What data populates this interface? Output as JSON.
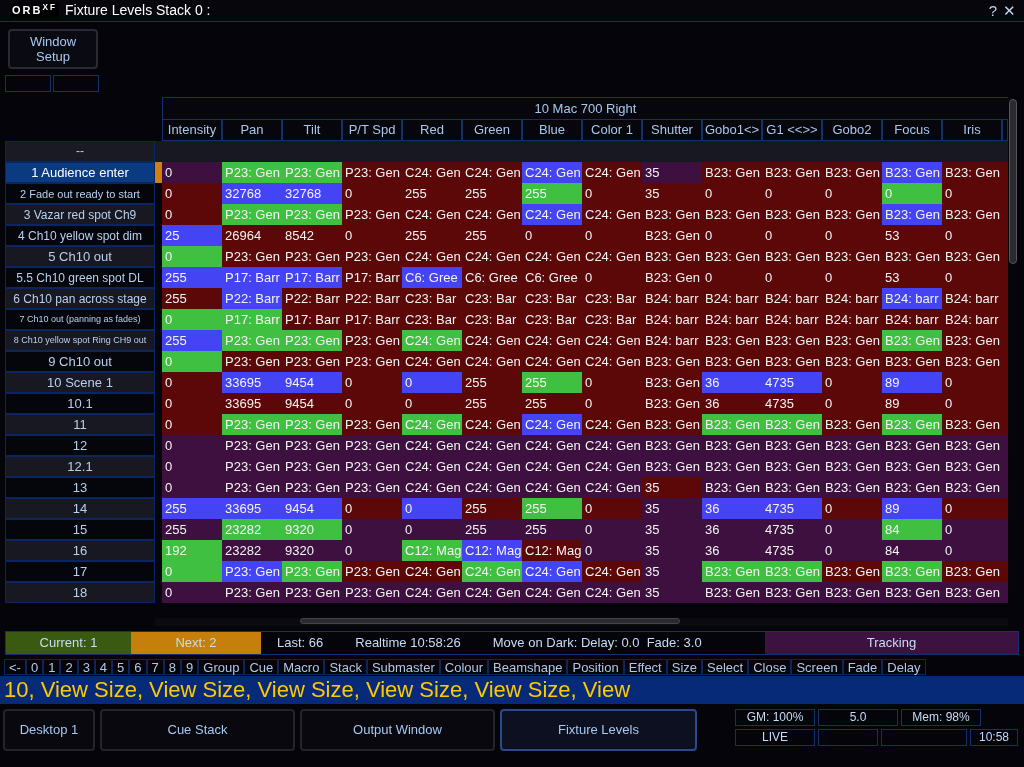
{
  "window": {
    "logo": "ORB$^{XF}$",
    "title": "Fixture Levels Stack 0 :",
    "title_buttons": [
      "?",
      "✕"
    ]
  },
  "window_setup_button": "Window\nSetup",
  "fixture_header": "10 Mac 700 Right",
  "columns": [
    "Intensity",
    "Pan",
    "Tilt",
    "P/T Spd",
    "Red",
    "Green",
    "Blue",
    "Color 1",
    "Shutter",
    "Gobo1<>",
    "G1 <<>>",
    "Gobo2",
    "Focus",
    "Iris"
  ],
  "blank_row": {
    "label": "--"
  },
  "rows": [
    {
      "label": "1 Audience enter",
      "selected": true,
      "color": "#5c0808",
      "cells": [
        {
          "text": "0",
          "color": "#3e1040"
        },
        {
          "text": "P23: Gen",
          "color": "#40c040"
        },
        {
          "text": "P23: Gen",
          "color": "#40c040"
        },
        {
          "text": "P23: Gen"
        },
        {
          "text": "C24: Gen"
        },
        {
          "text": "C24: Gen"
        },
        {
          "text": "C24: Gen",
          "color": "#4444f4"
        },
        {
          "text": "C24: Gen"
        },
        {
          "text": "35",
          "color": "#3e1040"
        },
        {
          "text": "B23: Gen"
        },
        {
          "text": "B23: Gen"
        },
        {
          "text": "B23: Gen"
        },
        {
          "text": "B23: Gen",
          "color": "#4444f4"
        },
        {
          "text": "B23: Gen"
        }
      ]
    },
    {
      "label": "2 Fade out ready to start",
      "selected": false,
      "color": "#5c0808",
      "cells": [
        {
          "text": "0"
        },
        {
          "text": "32768",
          "color": "#4444f4"
        },
        {
          "text": "32768",
          "color": "#4444f4"
        },
        {
          "text": "0"
        },
        {
          "text": "255"
        },
        {
          "text": "255"
        },
        {
          "text": "255",
          "color": "#40c040"
        },
        {
          "text": "0"
        },
        {
          "text": "35"
        },
        {
          "text": "0"
        },
        {
          "text": "0"
        },
        {
          "text": "0"
        },
        {
          "text": "0",
          "color": "#40c040"
        },
        {
          "text": "0"
        }
      ]
    },
    {
      "label": "3 Vazar red spot Ch9",
      "selected": false,
      "color": "#5c0808",
      "cells": [
        {
          "text": "0"
        },
        {
          "text": "P23: Gen",
          "color": "#40c040"
        },
        {
          "text": "P23: Gen",
          "color": "#40c040"
        },
        {
          "text": "P23: Gen"
        },
        {
          "text": "C24: Gen"
        },
        {
          "text": "C24: Gen"
        },
        {
          "text": "C24: Gen",
          "color": "#4444f4"
        },
        {
          "text": "C24: Gen"
        },
        {
          "text": "B23: Gen"
        },
        {
          "text": "B23: Gen"
        },
        {
          "text": "B23: Gen"
        },
        {
          "text": "B23: Gen"
        },
        {
          "text": "B23: Gen",
          "color": "#4444f4"
        },
        {
          "text": "B23: Gen"
        }
      ]
    },
    {
      "label": "4 Ch10 yellow spot dim",
      "selected": false,
      "color": "#5c0808",
      "cells": [
        {
          "text": "25",
          "color": "#4444f4"
        },
        {
          "text": "26964"
        },
        {
          "text": "8542"
        },
        {
          "text": "0"
        },
        {
          "text": "255"
        },
        {
          "text": "255"
        },
        {
          "text": "0"
        },
        {
          "text": "0"
        },
        {
          "text": "B23: Gen"
        },
        {
          "text": "0"
        },
        {
          "text": "0"
        },
        {
          "text": "0"
        },
        {
          "text": "53"
        },
        {
          "text": "0"
        }
      ]
    },
    {
      "label": "5 Ch10 out",
      "selected": false,
      "color": "#5c0808",
      "cells": [
        {
          "text": "0",
          "color": "#40c040"
        },
        {
          "text": "P23: Gen"
        },
        {
          "text": "P23: Gen"
        },
        {
          "text": "P23: Gen"
        },
        {
          "text": "C24: Gen"
        },
        {
          "text": "C24: Gen"
        },
        {
          "text": "C24: Gen"
        },
        {
          "text": "C24: Gen"
        },
        {
          "text": "B23: Gen"
        },
        {
          "text": "B23: Gen"
        },
        {
          "text": "B23: Gen"
        },
        {
          "text": "B23: Gen"
        },
        {
          "text": "B23: Gen"
        },
        {
          "text": "B23: Gen"
        }
      ]
    },
    {
      "label": "5.5 Ch10 green spot DL",
      "selected": false,
      "color": "#5c0808",
      "cells": [
        {
          "text": "255",
          "color": "#4444f4"
        },
        {
          "text": "P17: Barr",
          "color": "#4444f4"
        },
        {
          "text": "P17: Barr",
          "color": "#4444f4"
        },
        {
          "text": "P17: Barr"
        },
        {
          "text": "C6: Gree",
          "color": "#4444f4"
        },
        {
          "text": "C6: Gree"
        },
        {
          "text": "C6: Gree"
        },
        {
          "text": "0"
        },
        {
          "text": "B23: Gen"
        },
        {
          "text": "0"
        },
        {
          "text": "0"
        },
        {
          "text": "0"
        },
        {
          "text": "53"
        },
        {
          "text": "0"
        }
      ]
    },
    {
      "label": "6 Ch10 pan across stage",
      "selected": false,
      "color": "#5c0808",
      "cells": [
        {
          "text": "255"
        },
        {
          "text": "P22: Barr",
          "color": "#4444f4"
        },
        {
          "text": "P22: Barr"
        },
        {
          "text": "P22: Barr"
        },
        {
          "text": "C23: Bar"
        },
        {
          "text": "C23: Bar"
        },
        {
          "text": "C23: Bar"
        },
        {
          "text": "C23: Bar"
        },
        {
          "text": "B24: barr"
        },
        {
          "text": "B24: barr"
        },
        {
          "text": "B24: barr"
        },
        {
          "text": "B24: barr"
        },
        {
          "text": "B24: barr",
          "color": "#4444f4"
        },
        {
          "text": "B24: barr"
        }
      ]
    },
    {
      "label": "7 Ch10 out (panning as fades)",
      "selected": false,
      "color": "#5c0808",
      "cells": [
        {
          "text": "0",
          "color": "#40c040"
        },
        {
          "text": "P17: Barr",
          "color": "#40c040"
        },
        {
          "text": "P17: Barr"
        },
        {
          "text": "P17: Barr"
        },
        {
          "text": "C23: Bar"
        },
        {
          "text": "C23: Bar"
        },
        {
          "text": "C23: Bar"
        },
        {
          "text": "C23: Bar"
        },
        {
          "text": "B24: barr"
        },
        {
          "text": "B24: barr"
        },
        {
          "text": "B24: barr"
        },
        {
          "text": "B24: barr"
        },
        {
          "text": "B24: barr"
        },
        {
          "text": "B24: barr"
        }
      ]
    },
    {
      "label": "8 Ch10 yellow spot Ring CH9 out",
      "selected": false,
      "color": "#5c0808",
      "cells": [
        {
          "text": "255",
          "color": "#4444f4"
        },
        {
          "text": "P23: Gen",
          "color": "#40c040"
        },
        {
          "text": "P23: Gen",
          "color": "#40c040"
        },
        {
          "text": "P23: Gen"
        },
        {
          "text": "C24: Gen",
          "color": "#40c040"
        },
        {
          "text": "C24: Gen"
        },
        {
          "text": "C24: Gen"
        },
        {
          "text": "C24: Gen"
        },
        {
          "text": "B24: barr"
        },
        {
          "text": "B23: Gen"
        },
        {
          "text": "B23: Gen"
        },
        {
          "text": "B23: Gen"
        },
        {
          "text": "B23: Gen",
          "color": "#40c040"
        },
        {
          "text": "B23: Gen"
        }
      ]
    },
    {
      "label": "9 Ch10 out",
      "selected": false,
      "color": "#5c0808",
      "cells": [
        {
          "text": "0",
          "color": "#40c040"
        },
        {
          "text": "P23: Gen"
        },
        {
          "text": "P23: Gen"
        },
        {
          "text": "P23: Gen"
        },
        {
          "text": "C24: Gen"
        },
        {
          "text": "C24: Gen"
        },
        {
          "text": "C24: Gen"
        },
        {
          "text": "C24: Gen"
        },
        {
          "text": "B23: Gen"
        },
        {
          "text": "B23: Gen"
        },
        {
          "text": "B23: Gen"
        },
        {
          "text": "B23: Gen"
        },
        {
          "text": "B23: Gen"
        },
        {
          "text": "B23: Gen"
        }
      ]
    },
    {
      "label": "10 Scene 1",
      "selected": false,
      "color": "#5c0808",
      "cells": [
        {
          "text": "0"
        },
        {
          "text": "33695",
          "color": "#4444f4"
        },
        {
          "text": "9454",
          "color": "#4444f4"
        },
        {
          "text": "0"
        },
        {
          "text": "0",
          "color": "#4444f4"
        },
        {
          "text": "255"
        },
        {
          "text": "255",
          "color": "#40c040"
        },
        {
          "text": "0"
        },
        {
          "text": "B23: Gen"
        },
        {
          "text": "36",
          "color": "#4444f4"
        },
        {
          "text": "4735",
          "color": "#4444f4"
        },
        {
          "text": "0"
        },
        {
          "text": "89",
          "color": "#4444f4"
        },
        {
          "text": "0"
        }
      ]
    },
    {
      "label": "10.1",
      "selected": false,
      "color": "#5c0808",
      "cells": [
        {
          "text": "0"
        },
        {
          "text": "33695"
        },
        {
          "text": "9454"
        },
        {
          "text": "0"
        },
        {
          "text": "0"
        },
        {
          "text": "255"
        },
        {
          "text": "255"
        },
        {
          "text": "0"
        },
        {
          "text": "B23: Gen"
        },
        {
          "text": "36"
        },
        {
          "text": "4735"
        },
        {
          "text": "0"
        },
        {
          "text": "89"
        },
        {
          "text": "0"
        }
      ]
    },
    {
      "label": "11",
      "selected": false,
      "color": "#5c0808",
      "cells": [
        {
          "text": "0"
        },
        {
          "text": "P23: Gen",
          "color": "#40c040"
        },
        {
          "text": "P23: Gen",
          "color": "#40c040"
        },
        {
          "text": "P23: Gen"
        },
        {
          "text": "C24: Gen",
          "color": "#40c040"
        },
        {
          "text": "C24: Gen"
        },
        {
          "text": "C24: Gen",
          "color": "#4444f4"
        },
        {
          "text": "C24: Gen"
        },
        {
          "text": "B23: Gen"
        },
        {
          "text": "B23: Gen",
          "color": "#40c040"
        },
        {
          "text": "B23: Gen",
          "color": "#40c040"
        },
        {
          "text": "B23: Gen"
        },
        {
          "text": "B23: Gen",
          "color": "#40c040"
        },
        {
          "text": "B23: Gen"
        }
      ]
    },
    {
      "label": "12",
      "selected": false,
      "color": "#3e1040",
      "cells": [
        {
          "text": "0"
        },
        {
          "text": "P23: Gen"
        },
        {
          "text": "P23: Gen"
        },
        {
          "text": "P23: Gen"
        },
        {
          "text": "C24: Gen"
        },
        {
          "text": "C24: Gen"
        },
        {
          "text": "C24: Gen"
        },
        {
          "text": "C24: Gen"
        },
        {
          "text": "B23: Gen"
        },
        {
          "text": "B23: Gen"
        },
        {
          "text": "B23: Gen"
        },
        {
          "text": "B23: Gen"
        },
        {
          "text": "B23: Gen"
        },
        {
          "text": "B23: Gen"
        }
      ]
    },
    {
      "label": "12.1",
      "selected": false,
      "color": "#3e1040",
      "cells": [
        {
          "text": "0"
        },
        {
          "text": "P23: Gen"
        },
        {
          "text": "P23: Gen"
        },
        {
          "text": "P23: Gen"
        },
        {
          "text": "C24: Gen"
        },
        {
          "text": "C24: Gen"
        },
        {
          "text": "C24: Gen"
        },
        {
          "text": "C24: Gen"
        },
        {
          "text": "B23: Gen"
        },
        {
          "text": "B23: Gen"
        },
        {
          "text": "B23: Gen"
        },
        {
          "text": "B23: Gen"
        },
        {
          "text": "B23: Gen"
        },
        {
          "text": "B23: Gen"
        }
      ]
    },
    {
      "label": "13",
      "selected": false,
      "color": "#3e1040",
      "cells": [
        {
          "text": "0"
        },
        {
          "text": "P23: Gen"
        },
        {
          "text": "P23: Gen"
        },
        {
          "text": "P23: Gen"
        },
        {
          "text": "C24: Gen"
        },
        {
          "text": "C24: Gen"
        },
        {
          "text": "C24: Gen"
        },
        {
          "text": "C24: Gen"
        },
        {
          "text": "35",
          "color": "#5c0808"
        },
        {
          "text": "B23: Gen"
        },
        {
          "text": "B23: Gen"
        },
        {
          "text": "B23: Gen"
        },
        {
          "text": "B23: Gen"
        },
        {
          "text": "B23: Gen"
        }
      ]
    },
    {
      "label": "14",
      "selected": false,
      "color": "#5c0808",
      "cells": [
        {
          "text": "255",
          "color": "#4444f4"
        },
        {
          "text": "33695",
          "color": "#4444f4"
        },
        {
          "text": "9454",
          "color": "#4444f4"
        },
        {
          "text": "0"
        },
        {
          "text": "0",
          "color": "#4444f4"
        },
        {
          "text": "255"
        },
        {
          "text": "255",
          "color": "#40c040"
        },
        {
          "text": "0"
        },
        {
          "text": "35",
          "color": "#3e1040"
        },
        {
          "text": "36",
          "color": "#4444f4"
        },
        {
          "text": "4735",
          "color": "#4444f4"
        },
        {
          "text": "0"
        },
        {
          "text": "89",
          "color": "#4444f4"
        },
        {
          "text": "0"
        }
      ]
    },
    {
      "label": "15",
      "selected": false,
      "color": "#3e1040",
      "cells": [
        {
          "text": "255"
        },
        {
          "text": "23282",
          "color": "#40c040"
        },
        {
          "text": "9320",
          "color": "#40c040"
        },
        {
          "text": "0"
        },
        {
          "text": "0"
        },
        {
          "text": "255"
        },
        {
          "text": "255"
        },
        {
          "text": "0"
        },
        {
          "text": "35"
        },
        {
          "text": "36"
        },
        {
          "text": "4735"
        },
        {
          "text": "0"
        },
        {
          "text": "84",
          "color": "#40c040"
        },
        {
          "text": "0"
        }
      ]
    },
    {
      "label": "16",
      "selected": false,
      "color": "#3e1040",
      "cells": [
        {
          "text": "192",
          "color": "#40c040"
        },
        {
          "text": "23282"
        },
        {
          "text": "9320"
        },
        {
          "text": "0"
        },
        {
          "text": "C12: Mag",
          "color": "#40c040"
        },
        {
          "text": "C12: Mag",
          "color": "#4444f4"
        },
        {
          "text": "C12: Mag",
          "color": "#5c0808"
        },
        {
          "text": "0"
        },
        {
          "text": "35"
        },
        {
          "text": "36"
        },
        {
          "text": "4735"
        },
        {
          "text": "0"
        },
        {
          "text": "84"
        },
        {
          "text": "0"
        }
      ]
    },
    {
      "label": "17",
      "selected": false,
      "color": "#5c0808",
      "cells": [
        {
          "text": "0",
          "color": "#40c040"
        },
        {
          "text": "P23: Gen",
          "color": "#4444f4"
        },
        {
          "text": "P23: Gen",
          "color": "#40c040"
        },
        {
          "text": "P23: Gen"
        },
        {
          "text": "C24: Gen"
        },
        {
          "text": "C24: Gen",
          "color": "#40c040"
        },
        {
          "text": "C24: Gen",
          "color": "#4444f4"
        },
        {
          "text": "C24: Gen"
        },
        {
          "text": "35",
          "color": "#3e1040"
        },
        {
          "text": "B23: Gen",
          "color": "#40c040"
        },
        {
          "text": "B23: Gen",
          "color": "#40c040"
        },
        {
          "text": "B23: Gen"
        },
        {
          "text": "B23: Gen",
          "color": "#40c040"
        },
        {
          "text": "B23: Gen"
        }
      ]
    },
    {
      "label": "18",
      "selected": false,
      "color": "#3e1040",
      "cells": [
        {
          "text": "0"
        },
        {
          "text": "P23: Gen"
        },
        {
          "text": "P23: Gen"
        },
        {
          "text": "P23: Gen"
        },
        {
          "text": "C24: Gen"
        },
        {
          "text": "C24: Gen"
        },
        {
          "text": "C24: Gen"
        },
        {
          "text": "C24: Gen"
        },
        {
          "text": "35"
        },
        {
          "text": "B23: Gen"
        },
        {
          "text": "B23: Gen"
        },
        {
          "text": "B23: Gen"
        },
        {
          "text": "B23: Gen"
        },
        {
          "text": "B23: Gen"
        }
      ]
    }
  ],
  "status_bar": [
    {
      "kind": "current",
      "text": "Current: 1"
    },
    {
      "kind": "next",
      "text": "Next: 2"
    },
    {
      "kind": "plain",
      "text": "Last: 66"
    },
    {
      "kind": "plain",
      "text": "Realtime 10:58:26"
    },
    {
      "kind": "plain",
      "text": "Move on Dark: Delay: 0.0  Fade: 3.0"
    },
    {
      "kind": "mode",
      "text": "Tracking"
    }
  ],
  "keys": [
    "<-",
    "0",
    "1",
    "2",
    "3",
    "4",
    "5",
    "6",
    "7",
    "8",
    "9",
    "Group",
    "Cue",
    "Macro",
    "Stack",
    "Submaster",
    "Colour",
    "Beamshape",
    "Position",
    "Effect",
    "Size",
    "Select",
    "Close",
    "Screen",
    "Fade",
    "Delay"
  ],
  "command_line": "10, View Size, View Size, View Size, View Size, View Size, View",
  "desktop_buttons": [
    {
      "label": "Desktop 1",
      "selected": false
    },
    {
      "label": "Cue Stack",
      "selected": false
    },
    {
      "label": "Output Window",
      "selected": false
    },
    {
      "label": "Fixture Levels",
      "selected": true
    }
  ],
  "info": [
    [
      "GM: 100%",
      "5.0",
      "Mem: 98%"
    ],
    [
      "LIVE",
      "10:58"
    ]
  ]
}
